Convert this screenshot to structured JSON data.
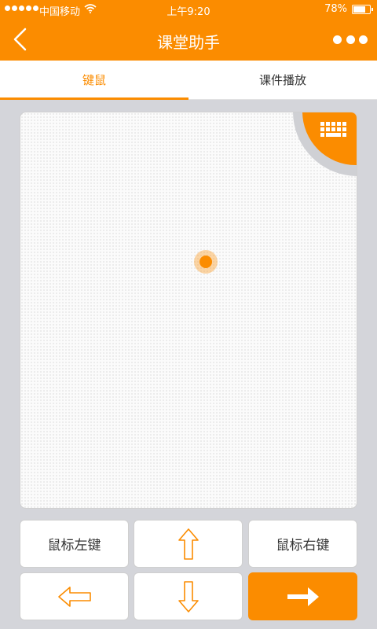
{
  "status_bar": {
    "carrier": "中国移动",
    "time": "上午9:20",
    "battery": "78%"
  },
  "nav": {
    "title": "课堂助手"
  },
  "tabs": [
    {
      "label": "键鼠",
      "active": true
    },
    {
      "label": "课件播放",
      "active": false
    }
  ],
  "controls": {
    "left_click": "鼠标左键",
    "right_click": "鼠标右键"
  },
  "colors": {
    "accent": "#fb8c00",
    "background": "#d4d5da"
  },
  "icons": [
    "back-chevron-icon",
    "more-dots-icon",
    "keyboard-icon",
    "arrow-up-icon",
    "arrow-down-icon",
    "arrow-left-icon",
    "arrow-right-icon"
  ]
}
